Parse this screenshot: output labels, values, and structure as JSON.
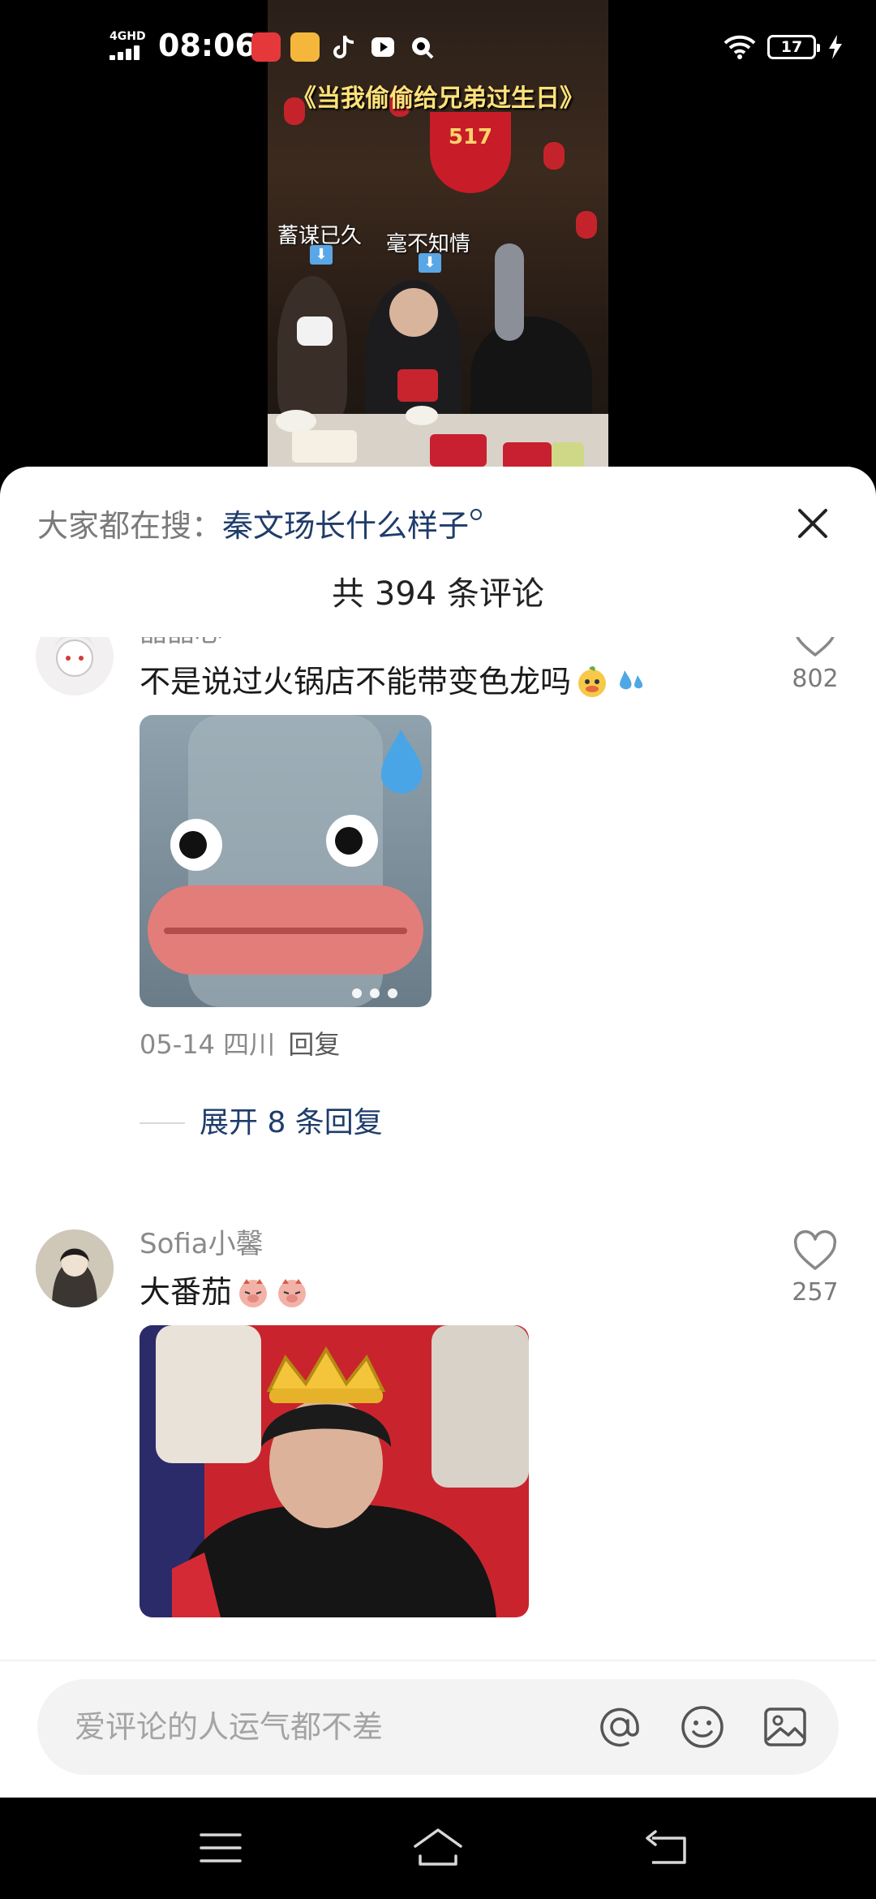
{
  "status_bar": {
    "network": "4GHD",
    "time": "08:06",
    "battery": "17",
    "app_icons": [
      "red-app-icon",
      "green-app-icon",
      "tiktok-icon",
      "video-play-icon",
      "search-app-icon"
    ]
  },
  "video": {
    "title": "《当我偷偷给兄弟过生日》",
    "banner_text": "517",
    "annotation_left": "蓄谋已久",
    "annotation_right": "毫不知情"
  },
  "comments_sheet": {
    "search_prefix": "大家都在搜：",
    "search_query": "秦文玚长什么样子",
    "comment_count": "共 394 条评论"
  },
  "comments": [
    {
      "username": "晶晶心",
      "text": "不是说过火锅店不能带变色龙吗",
      "emoji": [
        "duck-emoji",
        "sweat-drops-emoji"
      ],
      "meta_date": "05-14",
      "meta_location": "四川",
      "reply_label": "回复",
      "likes": "802",
      "expand_label": "展开 8 条回复"
    },
    {
      "username": "Sofia小馨",
      "text": "大番茄",
      "emoji": [
        "pig-emoji",
        "pig-emoji"
      ],
      "likes": "257"
    }
  ],
  "input_bar": {
    "placeholder": "爱评论的人运气都不差",
    "icons": [
      "at-icon",
      "smiley-icon",
      "image-icon"
    ]
  },
  "nav_bar": {
    "icons": [
      "menu-icon",
      "home-icon",
      "back-icon"
    ]
  },
  "colors": {
    "link_blue": "#1f3c6b",
    "meta_gray": "#8a8a8a",
    "sheet_bg": "#ffffff",
    "input_bg": "#f3f3f3"
  }
}
